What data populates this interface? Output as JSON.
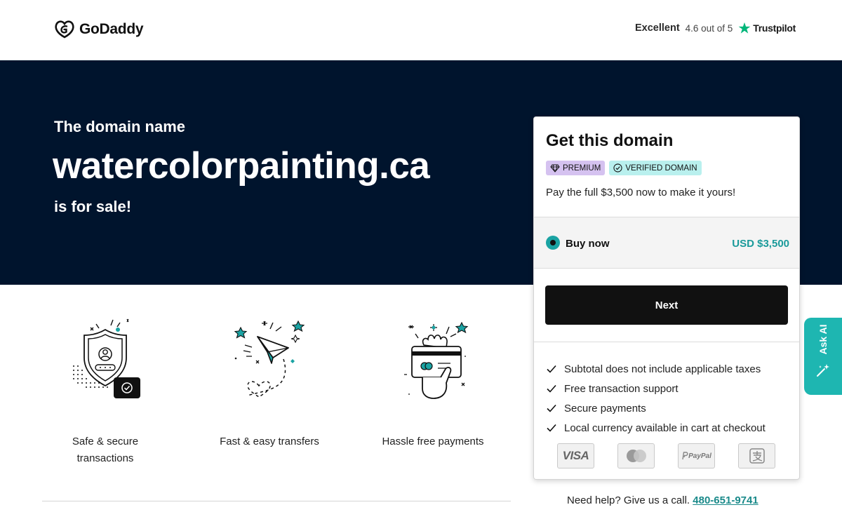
{
  "header": {
    "logo_text": "GoDaddy",
    "trust": {
      "rating_word": "Excellent",
      "score": "4.6 out of 5",
      "brand": "Trustpilot"
    }
  },
  "hero": {
    "pre": "The domain name",
    "domain": "watercolorpainting.ca",
    "post": "is for sale!"
  },
  "features": [
    {
      "line1": "Safe & secure",
      "line2": "transactions",
      "icon": "shield-user-icon"
    },
    {
      "line1": "Fast & easy transfers",
      "icon": "paper-plane-icon"
    },
    {
      "line1": "Hassle free payments",
      "icon": "hand-card-icon"
    }
  ],
  "card": {
    "title": "Get this domain",
    "badges": {
      "premium": "PREMIUM",
      "verified": "VERIFIED DOMAIN"
    },
    "pay_note": "Pay the full $3,500 now to make it yours!",
    "option": {
      "label": "Buy now",
      "price": "USD $3,500"
    },
    "next_label": "Next",
    "checks": [
      "Subtotal does not include applicable taxes",
      "Free transaction support",
      "Secure payments",
      "Local currency available in cart at checkout"
    ],
    "payment_methods": {
      "visa": "VISA",
      "mastercard": "mastercard",
      "paypal": "PayPal",
      "alipay": "alipay"
    }
  },
  "help": {
    "text": "Need help? Give us a call.",
    "phone": "480-651-9741"
  },
  "ask_ai": {
    "label": "Ask AI"
  },
  "colors": {
    "hero_bg": "#00142d",
    "accent_teal": "#1aa3a3",
    "button_bg": "#111111",
    "premium_badge": "#d5c2f0",
    "verified_badge": "#b9f0ee",
    "trustpilot_star": "#00b67a"
  }
}
